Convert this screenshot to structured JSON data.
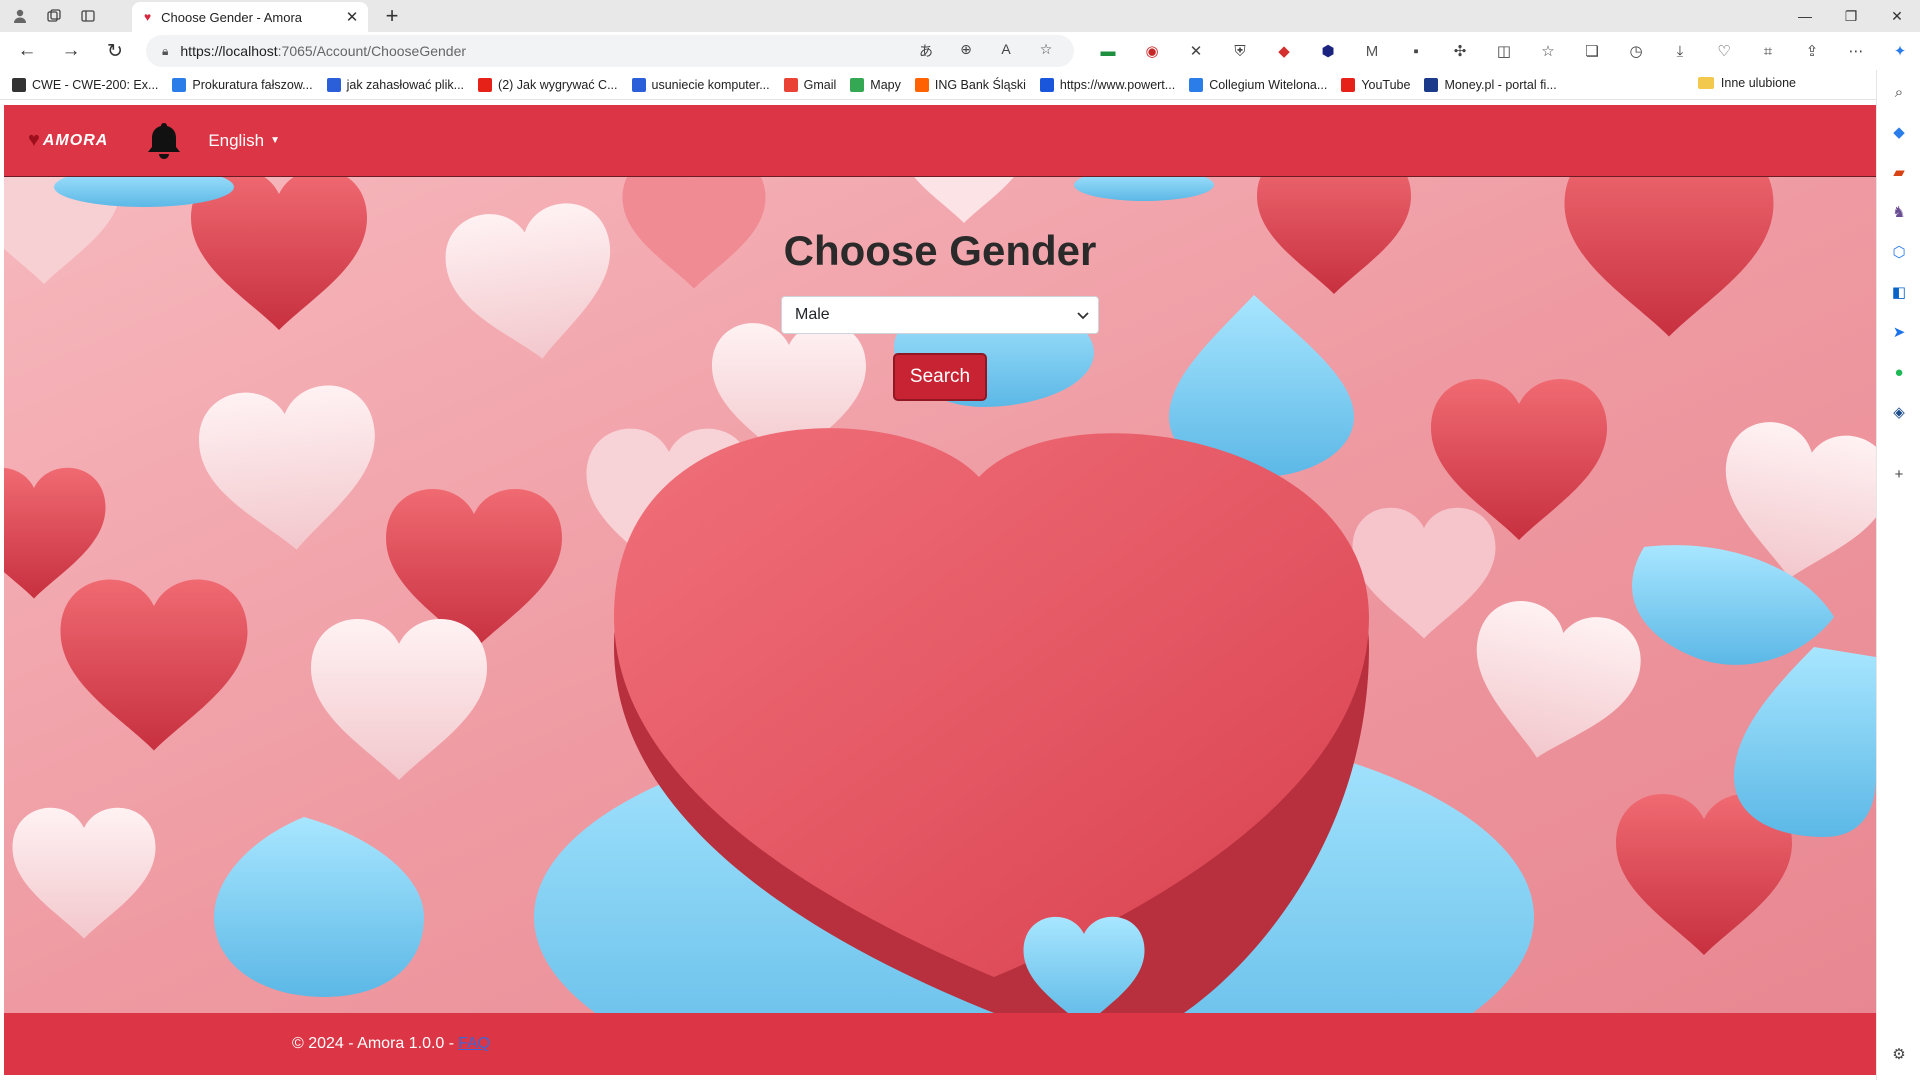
{
  "browser": {
    "tab_title": "Choose Gender - Amora",
    "url_host": "https://localhost",
    "url_path": ":7065/Account/ChooseGender",
    "bookmarks": [
      {
        "label": "CWE - CWE-200: Ex...",
        "color": "#333333"
      },
      {
        "label": "Prokuratura fałszow...",
        "color": "#2b7de9"
      },
      {
        "label": "jak zahasłować plik...",
        "color": "#2b5fd9"
      },
      {
        "label": "(2) Jak wygrywać C...",
        "color": "#e62117"
      },
      {
        "label": "usuniecie komputer...",
        "color": "#2b5fd9"
      },
      {
        "label": "Gmail",
        "color": "#ea4335"
      },
      {
        "label": "Mapy",
        "color": "#34a853"
      },
      {
        "label": "ING Bank Śląski",
        "color": "#ff6200"
      },
      {
        "label": "https://www.powert...",
        "color": "#1a56db"
      },
      {
        "label": "Collegium Witelona...",
        "color": "#2b7de9"
      },
      {
        "label": "YouTube",
        "color": "#e62117"
      },
      {
        "label": "Money.pl - portal fi...",
        "color": "#1b3a8a"
      }
    ],
    "bookmark_folder": "Inne ulubione"
  },
  "navbar": {
    "brand": "AMORA",
    "language": "English"
  },
  "main": {
    "title": "Choose Gender",
    "gender_selected": "Male",
    "search_label": "Search"
  },
  "footer": {
    "text": "© 2024 - Amora 1.0.0 -",
    "faq": "FAQ"
  },
  "colors": {
    "navbar": "#dc3545",
    "button": "#c82333"
  }
}
